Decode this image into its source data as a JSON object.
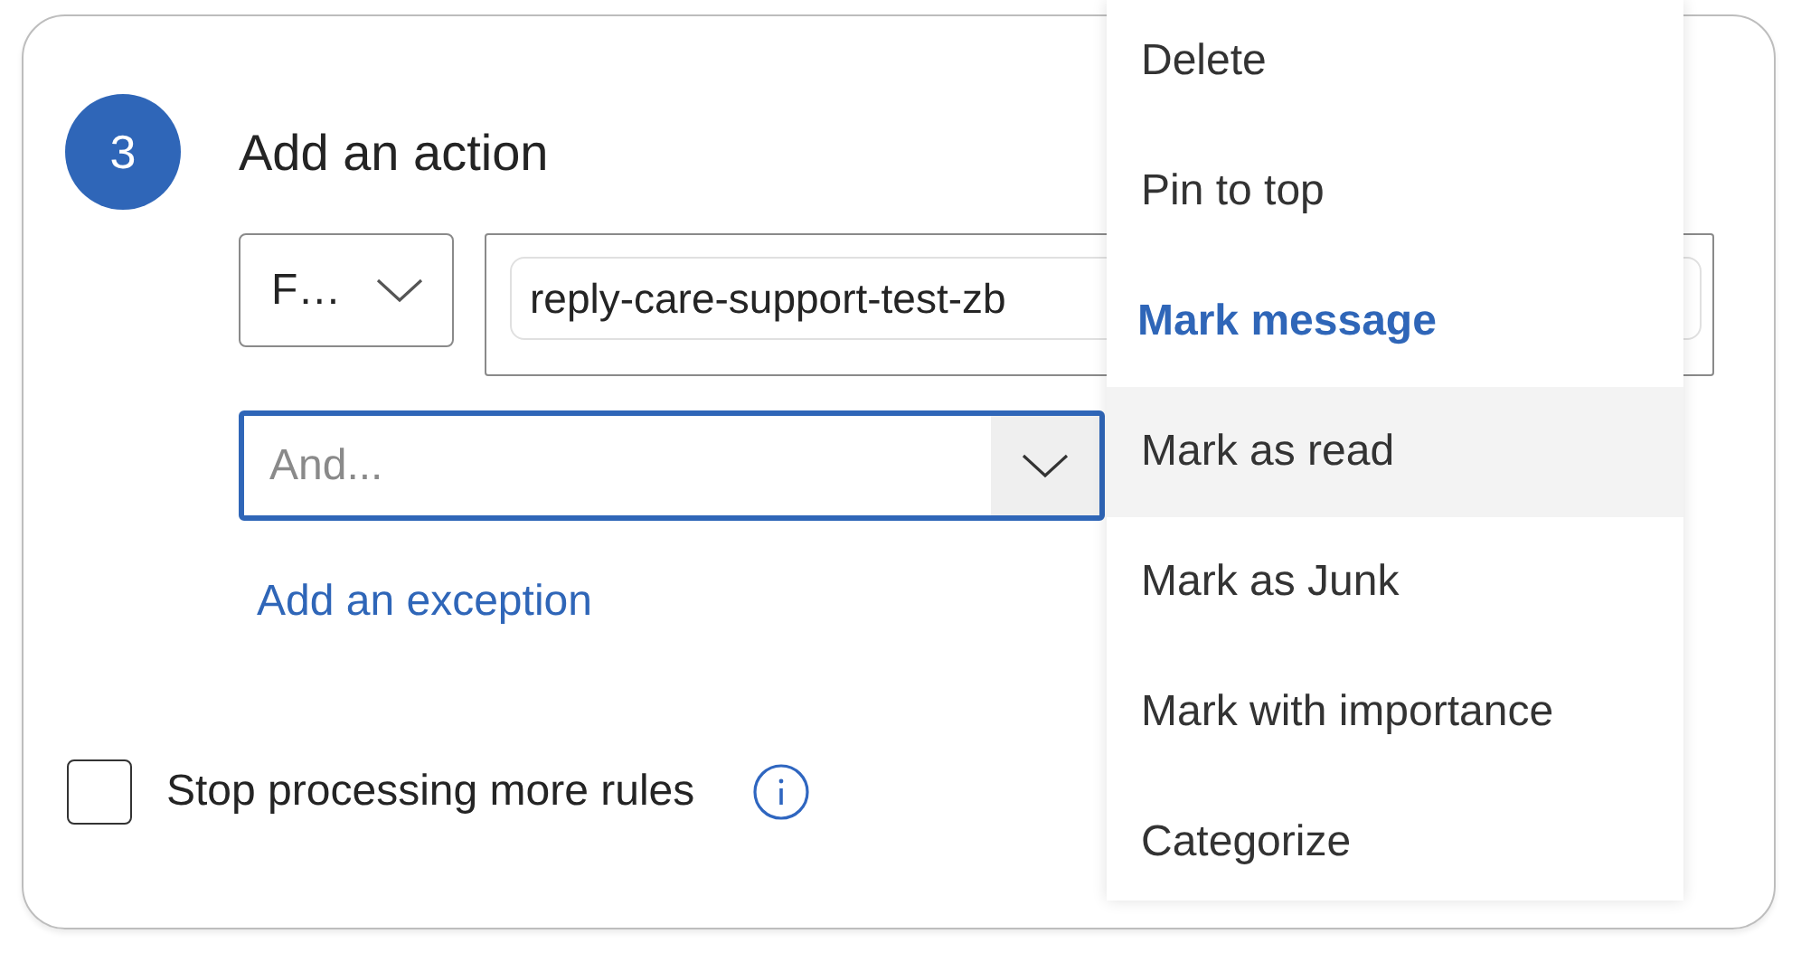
{
  "step": {
    "number": "3",
    "title": "Add an action"
  },
  "action": {
    "type_dropdown": "F…",
    "value_chip": "reply-care-support-test-zb"
  },
  "and_field": {
    "placeholder": "And...",
    "focused": true
  },
  "exception_link": "Add an exception",
  "stop_processing": {
    "label": "Stop processing more rules",
    "checked": false
  },
  "menu": {
    "items": [
      {
        "kind": "item",
        "label": "Delete",
        "selected": false
      },
      {
        "kind": "item",
        "label": "Pin to top",
        "selected": false
      },
      {
        "kind": "header",
        "label": "Mark message"
      },
      {
        "kind": "item",
        "label": "Mark as read",
        "selected": true
      },
      {
        "kind": "item",
        "label": "Mark as Junk",
        "selected": false
      },
      {
        "kind": "item",
        "label": "Mark with importance",
        "selected": false
      },
      {
        "kind": "item",
        "label": "Categorize",
        "selected": false
      }
    ]
  }
}
